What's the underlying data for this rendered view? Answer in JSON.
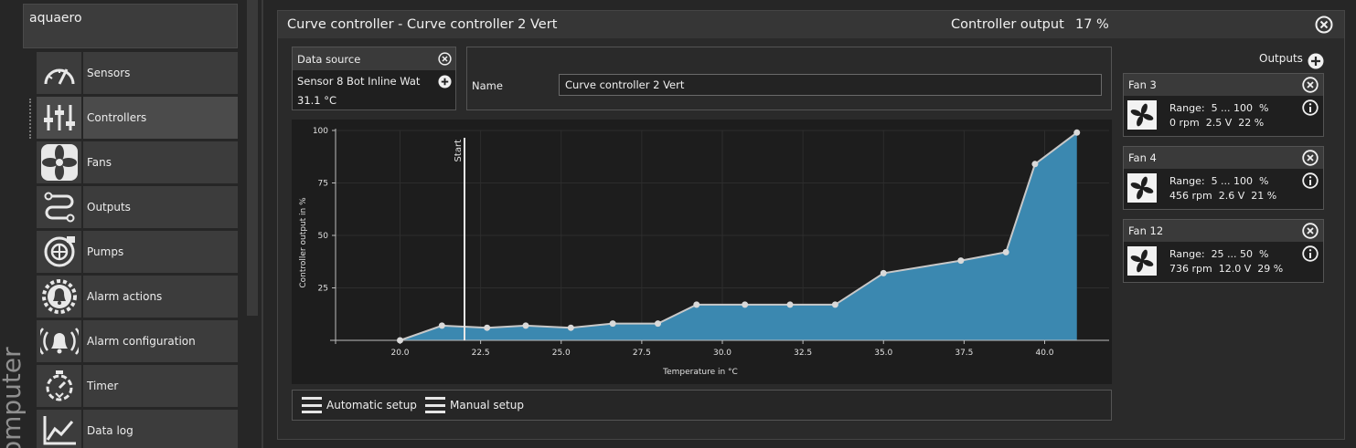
{
  "device": {
    "name": "aquaero"
  },
  "side_label": "omputer",
  "nav": [
    {
      "label": "Sensors",
      "icon": "gauge-icon"
    },
    {
      "label": "Controllers",
      "icon": "sliders-icon"
    },
    {
      "label": "Fans",
      "icon": "fan-icon"
    },
    {
      "label": "Outputs",
      "icon": "outputs-icon"
    },
    {
      "label": "Pumps",
      "icon": "pump-icon"
    },
    {
      "label": "Alarm actions",
      "icon": "bell-gear-icon"
    },
    {
      "label": "Alarm configuration",
      "icon": "bell-wave-icon"
    },
    {
      "label": "Timer",
      "icon": "timer-icon"
    },
    {
      "label": "Data log",
      "icon": "chart-icon"
    }
  ],
  "panel": {
    "title": "Curve controller  -  Curve controller 2 Vert",
    "output_label": "Controller output",
    "output_value": "17 %"
  },
  "data_source": {
    "header": "Data source",
    "sensor": "Sensor 8 Bot Inline Wat",
    "temperature": "31.1 °C"
  },
  "name_field": {
    "label": "Name",
    "value": "Curve controller 2 Vert"
  },
  "setup": {
    "automatic": "Automatic setup",
    "manual": "Manual setup"
  },
  "outputs": {
    "label": "Outputs",
    "fans": [
      {
        "name": "Fan 3",
        "range": "Range:  5 ... 100  %",
        "stats": "0 rpm  2.5 V  22 %"
      },
      {
        "name": "Fan 4",
        "range": "Range:  5 ... 100  %",
        "stats": "456 rpm  2.6 V  21 %"
      },
      {
        "name": "Fan 12",
        "range": "Range:  25 ... 50  %",
        "stats": "736 rpm  12.0 V  29 %"
      }
    ]
  },
  "colors": {
    "fill": "#3b88b0",
    "line": "#c8c8c8",
    "point": "#d9d9d9",
    "accent_bg": "#2a2a2a"
  },
  "chart_data": {
    "type": "area",
    "xlabel": "Temperature in °C",
    "ylabel": "Controller output in %",
    "xlim": [
      18.0,
      42.0
    ],
    "ylim": [
      0,
      100
    ],
    "xticks": [
      "20.0",
      "22.5",
      "25.0",
      "27.5",
      "30.0",
      "32.5",
      "35.0",
      "37.5",
      "40.0"
    ],
    "xtick_values": [
      20.0,
      22.5,
      25.0,
      27.5,
      30.0,
      32.5,
      35.0,
      37.5,
      40.0
    ],
    "yticks": [
      "25",
      "50",
      "75",
      "100"
    ],
    "ytick_values": [
      25,
      50,
      75,
      100
    ],
    "marker": {
      "label": "Start",
      "x": 22.0
    },
    "points": [
      [
        20.0,
        0
      ],
      [
        21.3,
        7
      ],
      [
        22.7,
        6
      ],
      [
        23.9,
        7
      ],
      [
        25.3,
        6
      ],
      [
        26.6,
        8
      ],
      [
        28.0,
        8
      ],
      [
        29.2,
        17
      ],
      [
        30.7,
        17
      ],
      [
        32.1,
        17
      ],
      [
        33.5,
        17
      ],
      [
        35.0,
        32
      ],
      [
        37.4,
        38
      ],
      [
        38.8,
        42
      ],
      [
        39.7,
        84
      ],
      [
        41.0,
        99
      ]
    ]
  }
}
